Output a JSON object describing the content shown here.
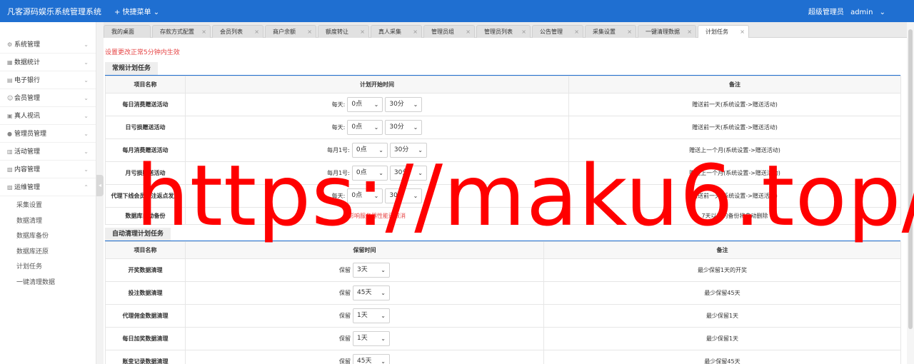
{
  "header": {
    "brand": "凡客源码娱乐系统管理系统",
    "quick_menu": "+ 快捷菜单",
    "role": "超级管理员",
    "username": "admin"
  },
  "sidebar": {
    "items": [
      {
        "label": "系统管理",
        "icon": "gear-icon"
      },
      {
        "label": "数据统计",
        "icon": "chart-icon"
      },
      {
        "label": "电子银行",
        "icon": "bank-icon"
      },
      {
        "label": "会员管理",
        "icon": "user-icon"
      },
      {
        "label": "真人视讯",
        "icon": "video-icon"
      },
      {
        "label": "管理员管理",
        "icon": "admin-icon"
      },
      {
        "label": "活动管理",
        "icon": "calendar-icon"
      },
      {
        "label": "内容管理",
        "icon": "content-icon"
      },
      {
        "label": "运维管理",
        "icon": "ops-icon"
      }
    ],
    "subitems": [
      "采集设置",
      "数据清理",
      "数据库备份",
      "数据库还原",
      "计划任务",
      "一键清理数据"
    ]
  },
  "tabs": [
    {
      "label": "我的桌面"
    },
    {
      "label": "存款方式配置"
    },
    {
      "label": "会员列表"
    },
    {
      "label": "商户余额"
    },
    {
      "label": "额度转让"
    },
    {
      "label": "真人采集"
    },
    {
      "label": "管理员组"
    },
    {
      "label": "管理员列表"
    },
    {
      "label": "公告管理"
    },
    {
      "label": "采集设置"
    },
    {
      "label": "一键清理数据"
    },
    {
      "label": "计划任务"
    }
  ],
  "notice": "设置更改正常5分钟内生效",
  "regular": {
    "title": "常规计划任务",
    "headers": [
      "项目名称",
      "计划开始时间",
      "备注"
    ],
    "rows": [
      {
        "name": "每日消费赠送活动",
        "prefix": "每天:",
        "sel1": "0点",
        "sel2": "30分",
        "note": "赠送前一天(系统设置->赠送活动)"
      },
      {
        "name": "日亏损赠送活动",
        "prefix": "每天:",
        "sel1": "0点",
        "sel2": "30分",
        "note": "赠送前一天(系统设置->赠送活动)"
      },
      {
        "name": "每月消费赠送活动",
        "prefix": "每月1号:",
        "sel1": "0点",
        "sel2": "30分",
        "note": "赠送上一个月(系统设置->赠送活动)"
      },
      {
        "name": "月亏损赠送活动",
        "prefix": "每月1号:",
        "sel1": "0点",
        "sel2": "30分",
        "note": "赠送上一个月(系统设置->赠送活动)"
      },
      {
        "name": "代理下线会员投注返点发放",
        "prefix": "每天:",
        "sel1": "0点",
        "sel2": "30分",
        "note": "赠送前一天(系统设置->赠送活动)"
      },
      {
        "name": "数据库自动备份",
        "warn": "影响服务器性能已取消",
        "note": "7天以前的备份将自动删除"
      }
    ]
  },
  "cleanup": {
    "title": "自动清理计划任务",
    "headers": [
      "项目名称",
      "保留时间",
      "备注"
    ],
    "rows": [
      {
        "name": "开奖数据清理",
        "prefix": "保留",
        "sel": "3天",
        "note": "最少保留1天的开奖"
      },
      {
        "name": "投注数据清理",
        "prefix": "保留",
        "sel": "45天",
        "note": "最少保留45天"
      },
      {
        "name": "代理佣金数据清理",
        "prefix": "保留",
        "sel": "1天",
        "note": "最少保留1天"
      },
      {
        "name": "每日加奖数据清理",
        "prefix": "保留",
        "sel": "1天",
        "note": "最少保留1天"
      },
      {
        "name": "账变记录数据清理",
        "prefix": "保留",
        "sel": "45天",
        "note": "最少保留45天"
      }
    ]
  },
  "watermark": "https://maku6.top/"
}
